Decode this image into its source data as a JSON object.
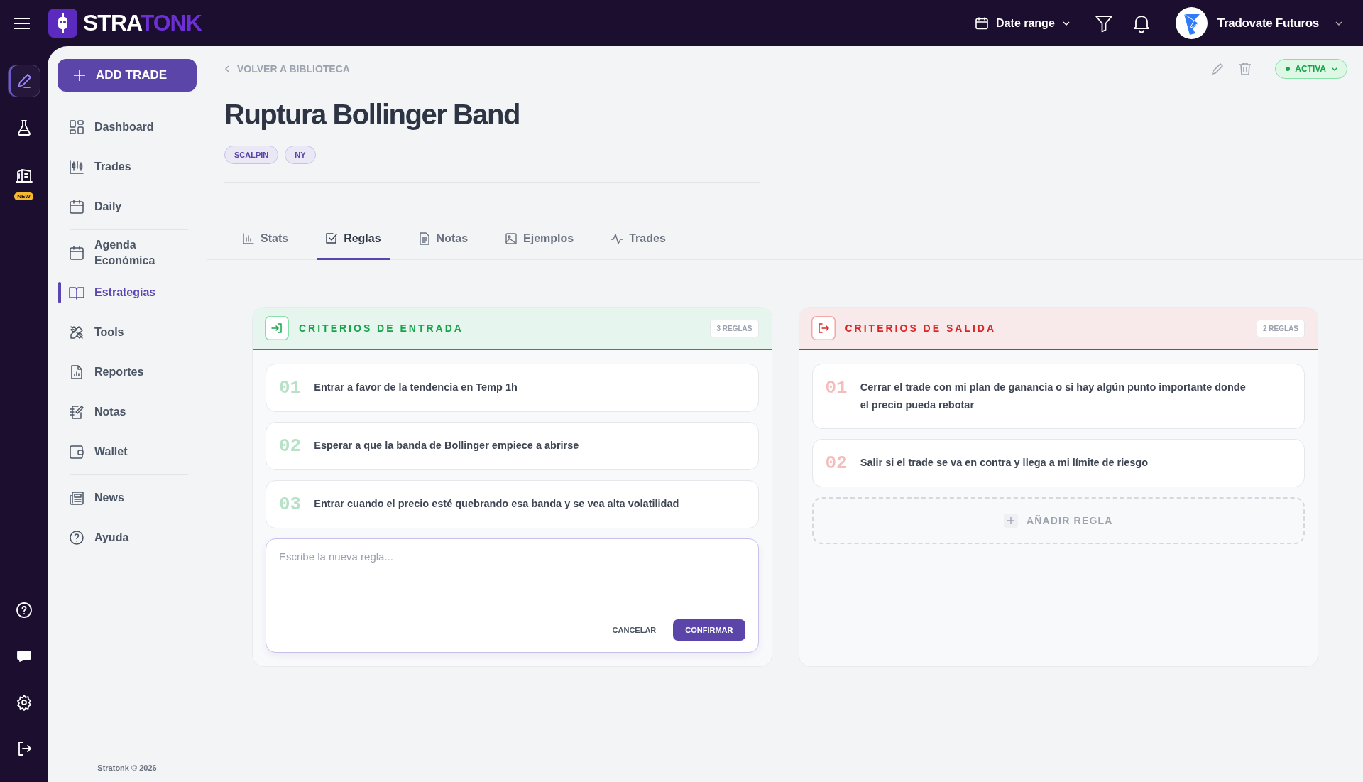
{
  "topbar": {
    "logo": {
      "text_1": "STRA",
      "text_2": "TONK"
    },
    "date_range": "Date range",
    "account": "Tradovate Futuros"
  },
  "rail": {
    "top": [
      {
        "selected": true
      },
      {
        "selected": false
      },
      {
        "selected": false,
        "badge": "NEW"
      }
    ],
    "bottom": [
      {
        "selected": false
      },
      {
        "selected": false
      },
      {
        "selected": false
      },
      {
        "selected": false
      }
    ]
  },
  "sidebar": {
    "add_button": "ADD TRADE",
    "groups": [
      [
        {
          "label": "Dashboard",
          "selected": false
        },
        {
          "label": "Trades",
          "selected": false
        },
        {
          "label": "Daily",
          "selected": false
        }
      ],
      [
        {
          "label": "Agenda Económica",
          "selected": false
        },
        {
          "label": "Estrategias",
          "selected": true
        },
        {
          "label": "Tools",
          "selected": false
        },
        {
          "label": "Reportes",
          "selected": false
        },
        {
          "label": "Notas",
          "selected": false
        },
        {
          "label": "Wallet",
          "selected": false
        }
      ],
      [
        {
          "label": "News",
          "selected": false
        },
        {
          "label": "Ayuda",
          "selected": false
        }
      ]
    ],
    "footer": "Stratonk © 2026"
  },
  "header": {
    "back_link": "VOLVER A BIBLIOTECA",
    "title": "Ruptura Bollinger Band",
    "tags": [
      "SCALPIN",
      "NY"
    ],
    "status": "ACTIVA"
  },
  "tabs": [
    {
      "label": "Stats",
      "selected": false
    },
    {
      "label": "Reglas",
      "selected": true
    },
    {
      "label": "Notas",
      "selected": false
    },
    {
      "label": "Ejemplos",
      "selected": false
    },
    {
      "label": "Trades",
      "selected": false
    }
  ],
  "panels": [
    {
      "kind": "entry",
      "title": "CRITERIOS DE ENTRADA",
      "count": "3 REGLAS",
      "rules": [
        {
          "number": "01",
          "text": "Entrar a favor de la tendencia en Temp 1h"
        },
        {
          "number": "02",
          "text": "Esperar a que la banda de Bollinger empiece a abrirse"
        },
        {
          "number": "03",
          "text": "Entrar cuando el precio esté quebrando esa banda y se vea alta volatilidad"
        }
      ],
      "editor": {
        "placeholder": "Escribe la nueva regla...",
        "cancel": "CANCELAR",
        "confirm": "CONFIRMAR"
      }
    },
    {
      "kind": "exit",
      "title": "CRITERIOS DE SALIDA",
      "count": "2 REGLAS",
      "rules": [
        {
          "number": "01",
          "text": "Cerrar el trade con mi plan de ganancia o si hay algún punto importante donde el precio pueda rebotar"
        },
        {
          "number": "02",
          "text": "Salir si el trade se va en contra y llega a mi límite de riesgo"
        }
      ],
      "add_button": "AÑADIR REGLA"
    }
  ]
}
